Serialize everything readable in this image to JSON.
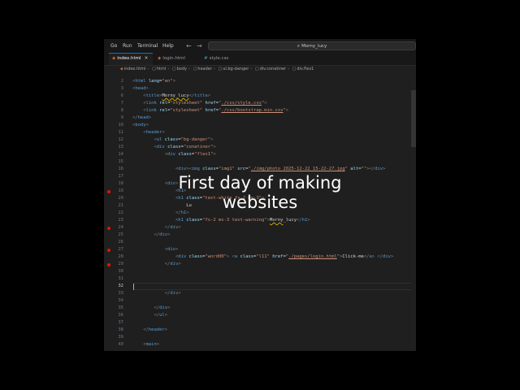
{
  "menu": {
    "items": [
      "Go",
      "Run",
      "Terminal",
      "Help"
    ],
    "back_icon": "arrow-left-icon",
    "forward_icon": "arrow-right-icon"
  },
  "search": {
    "text": "Morny_lucy",
    "icon": "search-icon"
  },
  "tabs": [
    {
      "label": "index.html",
      "icon": "html-file-icon",
      "active": true,
      "close_icon": "close-icon"
    },
    {
      "label": "login.html",
      "icon": "html-file-icon",
      "active": false
    },
    {
      "label": "style.css",
      "icon": "css-file-icon",
      "active": false
    }
  ],
  "breadcrumb": [
    "index.html",
    "html",
    "body",
    "header",
    "ul.bg-danger",
    "div.conatiner",
    "div.flex1"
  ],
  "editor": {
    "current_line": "32",
    "lines": [
      {
        "n": "2",
        "html": "<span class='p'>&lt;</span><span class='t'>html</span> <span class='a'>lang</span>=<span class='s'>\"en\"</span><span class='p'>&gt;</span>"
      },
      {
        "n": "3",
        "html": "<span class='p'>&lt;</span><span class='t'>head</span><span class='p'>&gt;</span>"
      },
      {
        "n": "6",
        "html": "    <span class='p'>&lt;</span><span class='t'>title</span><span class='p'>&gt;</span><span class='warn'>Morny_lucy</span><span class='p'>&lt;/</span><span class='t'>title</span><span class='p'>&gt;</span>"
      },
      {
        "n": "7",
        "html": "    <span class='p'>&lt;</span><span class='t'>link</span> <span class='a'>rel</span>=<span class='s'>\"stylesheet\"</span> <span class='a'>href</span>=<span class='s'>\"<span class='u'>./css/style.css</span>\"</span><span class='p'>&gt;</span>"
      },
      {
        "n": "8",
        "html": "    <span class='p'>&lt;</span><span class='t'>link</span> <span class='a'>rel</span>=<span class='s'>\"stylesheet\"</span> <span class='a'>href</span>=<span class='s'>\"<span class='u'>./css/bootstrap.min.css</span>\"</span><span class='p'>&gt;</span>"
      },
      {
        "n": "9",
        "html": "<span class='p'>&lt;/</span><span class='t'>head</span><span class='p'>&gt;</span>"
      },
      {
        "n": "10",
        "html": "<span class='p'>&lt;</span><span class='t'>body</span><span class='p'>&gt;</span>"
      },
      {
        "n": "11",
        "html": "    <span class='p'>&lt;</span><span class='t'>header</span><span class='p'>&gt;</span>"
      },
      {
        "n": "12",
        "html": "        <span class='p'>&lt;</span><span class='t'>ul</span> <span class='a'>class</span>=<span class='s'>\"bg-danger\"</span><span class='p'>&gt;</span>"
      },
      {
        "n": "13",
        "html": "        <span class='p'>&lt;</span><span class='t'>div</span> <span class='a'>class</span>=<span class='s'>\"conatiner\"</span><span class='p'>&gt;</span>"
      },
      {
        "n": "14",
        "html": "            <span class='p'>&lt;</span><span class='t'>div</span> <span class='a'>class</span>=<span class='s'>\"flex1\"</span><span class='p'>&gt;</span>"
      },
      {
        "n": "15",
        "html": ""
      },
      {
        "n": "16",
        "html": "                <span class='p'>&lt;</span><span class='t'>div</span><span class='p'>&gt;&lt;</span><span class='t'>img</span> <span class='a'>class</span>=<span class='s'>\"img1\"</span> <span class='a'>src</span>=<span class='s'>\"<span class='u'>./img/photo_2025-12-22_15-22-27.jpg</span>\"</span> <span class='a'>alt</span>=<span class='s'>\"\"</span><span class='p'>&gt;&lt;/</span><span class='t'>div</span><span class='p'>&gt;</span>"
      },
      {
        "n": "17",
        "html": ""
      },
      {
        "n": "18",
        "html": "            <span class='p'>&lt;</span><span class='t'>div</span><span class='p'>&gt;</span>"
      },
      {
        "n": "19",
        "html": "                <span class='p'>&lt;</span><span class='t'>h1</span><span class='p'>&gt;</span>"
      },
      {
        "n": "20",
        "html": "                <span class='p'>&lt;</span><span class='t'>h1</span> <span class='a'>class</span>=<span class='s'>\"text-white fs-2 ms-3\"</span><span class='p'>&gt;</span>"
      },
      {
        "n": "21",
        "html": "                    Lu"
      },
      {
        "n": "22",
        "html": "                <span class='p'>&lt;/</span><span class='t'>h1</span><span class='p'>&gt;</span>"
      },
      {
        "n": "23",
        "html": "                <span class='p'>&lt;</span><span class='t'>h1</span> <span class='a'>class</span>=<span class='s'>\"fs-2 ms-3 text-warning\"</span><span class='p'>&gt;</span><span class='warn'>Morny</span>_lucy<span class='p'>&lt;/</span><span class='t'>h1</span><span class='p'>&gt;</span>"
      },
      {
        "n": "24",
        "html": "            <span class='p'>&lt;/</span><span class='t'>div</span><span class='p'>&gt;</span>"
      },
      {
        "n": "25",
        "html": "        <span class='p'>&lt;/</span><span class='t'>div</span><span class='p'>&gt;</span>"
      },
      {
        "n": "26",
        "html": ""
      },
      {
        "n": "27",
        "html": "            <span class='p'>&lt;</span><span class='t'>div</span><span class='p'>&gt;</span>"
      },
      {
        "n": "28",
        "html": "                <span class='p'>&lt;</span><span class='t'>div</span> <span class='a'>class</span>=<span class='s'>\"word00\"</span><span class='p'>&gt;</span> <span class='p'>&lt;</span><span class='t'>a</span> <span class='a'>class</span>=<span class='s'>\"l11\"</span> <span class='a'>href</span>=<span class='s'>\"<span class='u'>./pages/login.html</span>\"</span><span class='p'>&gt;</span>Click-me<span class='p'>&lt;/</span><span class='t'>a</span><span class='p'>&gt;</span> <span class='p'>&lt;/</span><span class='t'>div</span><span class='p'>&gt;</span>"
      },
      {
        "n": "29",
        "html": "            <span class='p'>&lt;/</span><span class='t'>div</span><span class='p'>&gt;</span>"
      },
      {
        "n": "30",
        "html": ""
      },
      {
        "n": "31",
        "html": ""
      },
      {
        "n": "32",
        "html": ""
      },
      {
        "n": "33",
        "html": "            <span class='p'>&lt;/</span><span class='t'>div</span><span class='p'>&gt;</span>"
      },
      {
        "n": "34",
        "html": ""
      },
      {
        "n": "35",
        "html": "        <span class='p'>&lt;/</span><span class='t'>div</span><span class='p'>&gt;</span>"
      },
      {
        "n": "36",
        "html": "        <span class='p'>&lt;/</span><span class='t'>ul</span><span class='p'>&gt;</span>"
      },
      {
        "n": "37",
        "html": ""
      },
      {
        "n": "38",
        "html": "    <span class='p'>&lt;/</span><span class='t'>header</span><span class='p'>&gt;</span>"
      },
      {
        "n": "39",
        "html": ""
      },
      {
        "n": "40",
        "html": "    <span class='p'>&lt;</span><span class='t'>main</span><span class='p'>&gt;</span>"
      }
    ],
    "breakpoints": [
      "19",
      "24",
      "27",
      "29"
    ]
  },
  "overlay": {
    "line1": "First day of making",
    "line2": "websites"
  },
  "colors": {
    "background": "#1f1f1f",
    "accent": "#0078d4",
    "tag": "#569cd6",
    "attr": "#9cdcfe",
    "string": "#ce9178",
    "breakpoint": "#e51400"
  }
}
